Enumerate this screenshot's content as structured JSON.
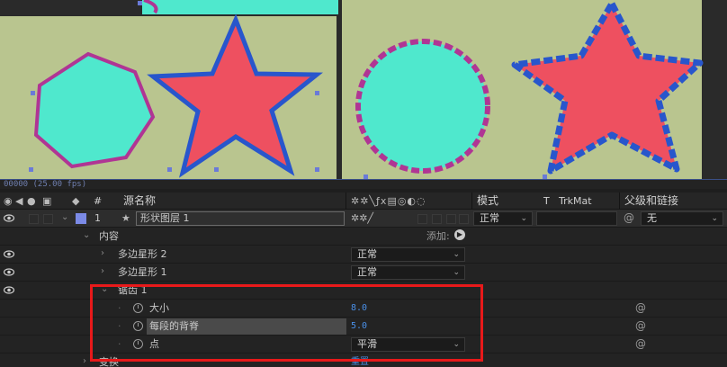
{
  "viewer": {
    "timecode": "00000 (25.00 fps)"
  },
  "header": {
    "hash": "#",
    "source_name": "源名称",
    "mode": "模式",
    "t": "T",
    "trkmat": "TrkMat",
    "parent_link": "父级和链接"
  },
  "layer": {
    "number": "1",
    "name": "形状图层 1",
    "mode_value": "正常",
    "parent_value": "无"
  },
  "contents": {
    "label": "内容",
    "add_label": "添加:"
  },
  "polystar2": {
    "label": "多边星形 2",
    "mode": "正常"
  },
  "polystar1": {
    "label": "多边星形 1",
    "mode": "正常"
  },
  "zigzag": {
    "label": "锯齿 1",
    "size_label": "大小",
    "size_value": "8.0",
    "ridges_label": "每段的背脊",
    "ridges_value": "5.0",
    "points_label": "点",
    "points_value": "平滑"
  },
  "transform": {
    "label": "变换",
    "value": "重置"
  },
  "colors": {
    "teal": "#4fe8cd",
    "red": "#ee5060",
    "magenta": "#b03594",
    "blue": "#2856cc",
    "canvas": "#b9c58f",
    "highlight": "#e8191a"
  }
}
